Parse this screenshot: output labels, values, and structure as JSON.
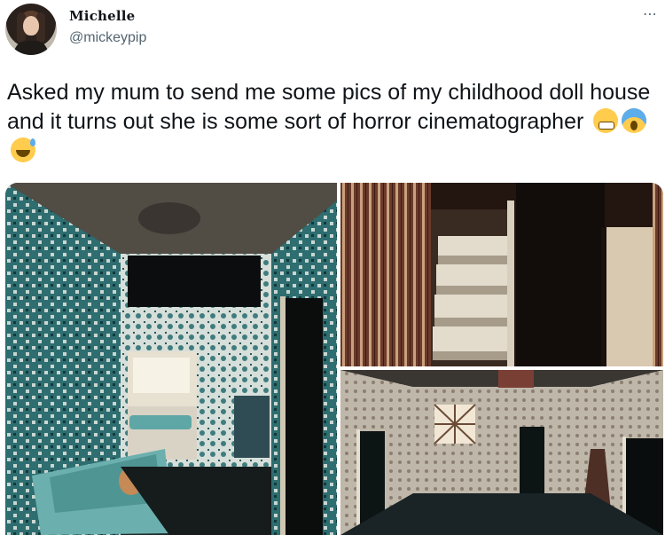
{
  "author": {
    "display_name": "Michelle",
    "handle": "@mickeypip"
  },
  "more_icon": "⋯",
  "tweet": {
    "text": "Asked my mum to send me some pics of my childhood doll house and it turns out she is some sort of horror cinematographer",
    "emojis": [
      "grimacing-face",
      "face-screaming-in-fear",
      "grinning-face-with-sweat"
    ]
  },
  "media": {
    "photos": [
      "bathroom",
      "staircase",
      "hallway"
    ]
  }
}
